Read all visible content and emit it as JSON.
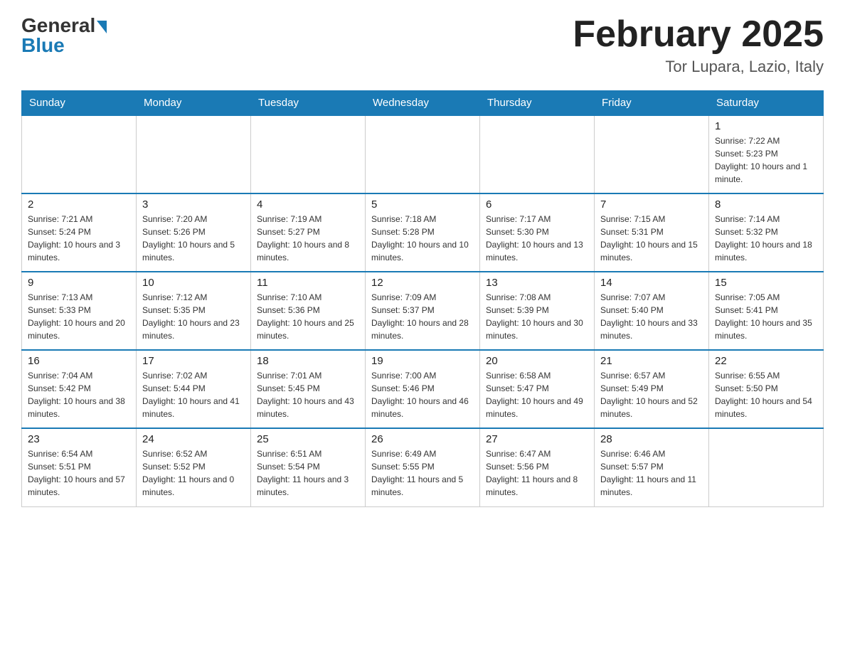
{
  "header": {
    "logo_general": "General",
    "logo_blue": "Blue",
    "title": "February 2025",
    "subtitle": "Tor Lupara, Lazio, Italy"
  },
  "days_of_week": [
    "Sunday",
    "Monday",
    "Tuesday",
    "Wednesday",
    "Thursday",
    "Friday",
    "Saturday"
  ],
  "weeks": [
    {
      "days": [
        {
          "num": "",
          "info": ""
        },
        {
          "num": "",
          "info": ""
        },
        {
          "num": "",
          "info": ""
        },
        {
          "num": "",
          "info": ""
        },
        {
          "num": "",
          "info": ""
        },
        {
          "num": "",
          "info": ""
        },
        {
          "num": "1",
          "info": "Sunrise: 7:22 AM\nSunset: 5:23 PM\nDaylight: 10 hours and 1 minute."
        }
      ]
    },
    {
      "days": [
        {
          "num": "2",
          "info": "Sunrise: 7:21 AM\nSunset: 5:24 PM\nDaylight: 10 hours and 3 minutes."
        },
        {
          "num": "3",
          "info": "Sunrise: 7:20 AM\nSunset: 5:26 PM\nDaylight: 10 hours and 5 minutes."
        },
        {
          "num": "4",
          "info": "Sunrise: 7:19 AM\nSunset: 5:27 PM\nDaylight: 10 hours and 8 minutes."
        },
        {
          "num": "5",
          "info": "Sunrise: 7:18 AM\nSunset: 5:28 PM\nDaylight: 10 hours and 10 minutes."
        },
        {
          "num": "6",
          "info": "Sunrise: 7:17 AM\nSunset: 5:30 PM\nDaylight: 10 hours and 13 minutes."
        },
        {
          "num": "7",
          "info": "Sunrise: 7:15 AM\nSunset: 5:31 PM\nDaylight: 10 hours and 15 minutes."
        },
        {
          "num": "8",
          "info": "Sunrise: 7:14 AM\nSunset: 5:32 PM\nDaylight: 10 hours and 18 minutes."
        }
      ]
    },
    {
      "days": [
        {
          "num": "9",
          "info": "Sunrise: 7:13 AM\nSunset: 5:33 PM\nDaylight: 10 hours and 20 minutes."
        },
        {
          "num": "10",
          "info": "Sunrise: 7:12 AM\nSunset: 5:35 PM\nDaylight: 10 hours and 23 minutes."
        },
        {
          "num": "11",
          "info": "Sunrise: 7:10 AM\nSunset: 5:36 PM\nDaylight: 10 hours and 25 minutes."
        },
        {
          "num": "12",
          "info": "Sunrise: 7:09 AM\nSunset: 5:37 PM\nDaylight: 10 hours and 28 minutes."
        },
        {
          "num": "13",
          "info": "Sunrise: 7:08 AM\nSunset: 5:39 PM\nDaylight: 10 hours and 30 minutes."
        },
        {
          "num": "14",
          "info": "Sunrise: 7:07 AM\nSunset: 5:40 PM\nDaylight: 10 hours and 33 minutes."
        },
        {
          "num": "15",
          "info": "Sunrise: 7:05 AM\nSunset: 5:41 PM\nDaylight: 10 hours and 35 minutes."
        }
      ]
    },
    {
      "days": [
        {
          "num": "16",
          "info": "Sunrise: 7:04 AM\nSunset: 5:42 PM\nDaylight: 10 hours and 38 minutes."
        },
        {
          "num": "17",
          "info": "Sunrise: 7:02 AM\nSunset: 5:44 PM\nDaylight: 10 hours and 41 minutes."
        },
        {
          "num": "18",
          "info": "Sunrise: 7:01 AM\nSunset: 5:45 PM\nDaylight: 10 hours and 43 minutes."
        },
        {
          "num": "19",
          "info": "Sunrise: 7:00 AM\nSunset: 5:46 PM\nDaylight: 10 hours and 46 minutes."
        },
        {
          "num": "20",
          "info": "Sunrise: 6:58 AM\nSunset: 5:47 PM\nDaylight: 10 hours and 49 minutes."
        },
        {
          "num": "21",
          "info": "Sunrise: 6:57 AM\nSunset: 5:49 PM\nDaylight: 10 hours and 52 minutes."
        },
        {
          "num": "22",
          "info": "Sunrise: 6:55 AM\nSunset: 5:50 PM\nDaylight: 10 hours and 54 minutes."
        }
      ]
    },
    {
      "days": [
        {
          "num": "23",
          "info": "Sunrise: 6:54 AM\nSunset: 5:51 PM\nDaylight: 10 hours and 57 minutes."
        },
        {
          "num": "24",
          "info": "Sunrise: 6:52 AM\nSunset: 5:52 PM\nDaylight: 11 hours and 0 minutes."
        },
        {
          "num": "25",
          "info": "Sunrise: 6:51 AM\nSunset: 5:54 PM\nDaylight: 11 hours and 3 minutes."
        },
        {
          "num": "26",
          "info": "Sunrise: 6:49 AM\nSunset: 5:55 PM\nDaylight: 11 hours and 5 minutes."
        },
        {
          "num": "27",
          "info": "Sunrise: 6:47 AM\nSunset: 5:56 PM\nDaylight: 11 hours and 8 minutes."
        },
        {
          "num": "28",
          "info": "Sunrise: 6:46 AM\nSunset: 5:57 PM\nDaylight: 11 hours and 11 minutes."
        },
        {
          "num": "",
          "info": ""
        }
      ]
    }
  ]
}
